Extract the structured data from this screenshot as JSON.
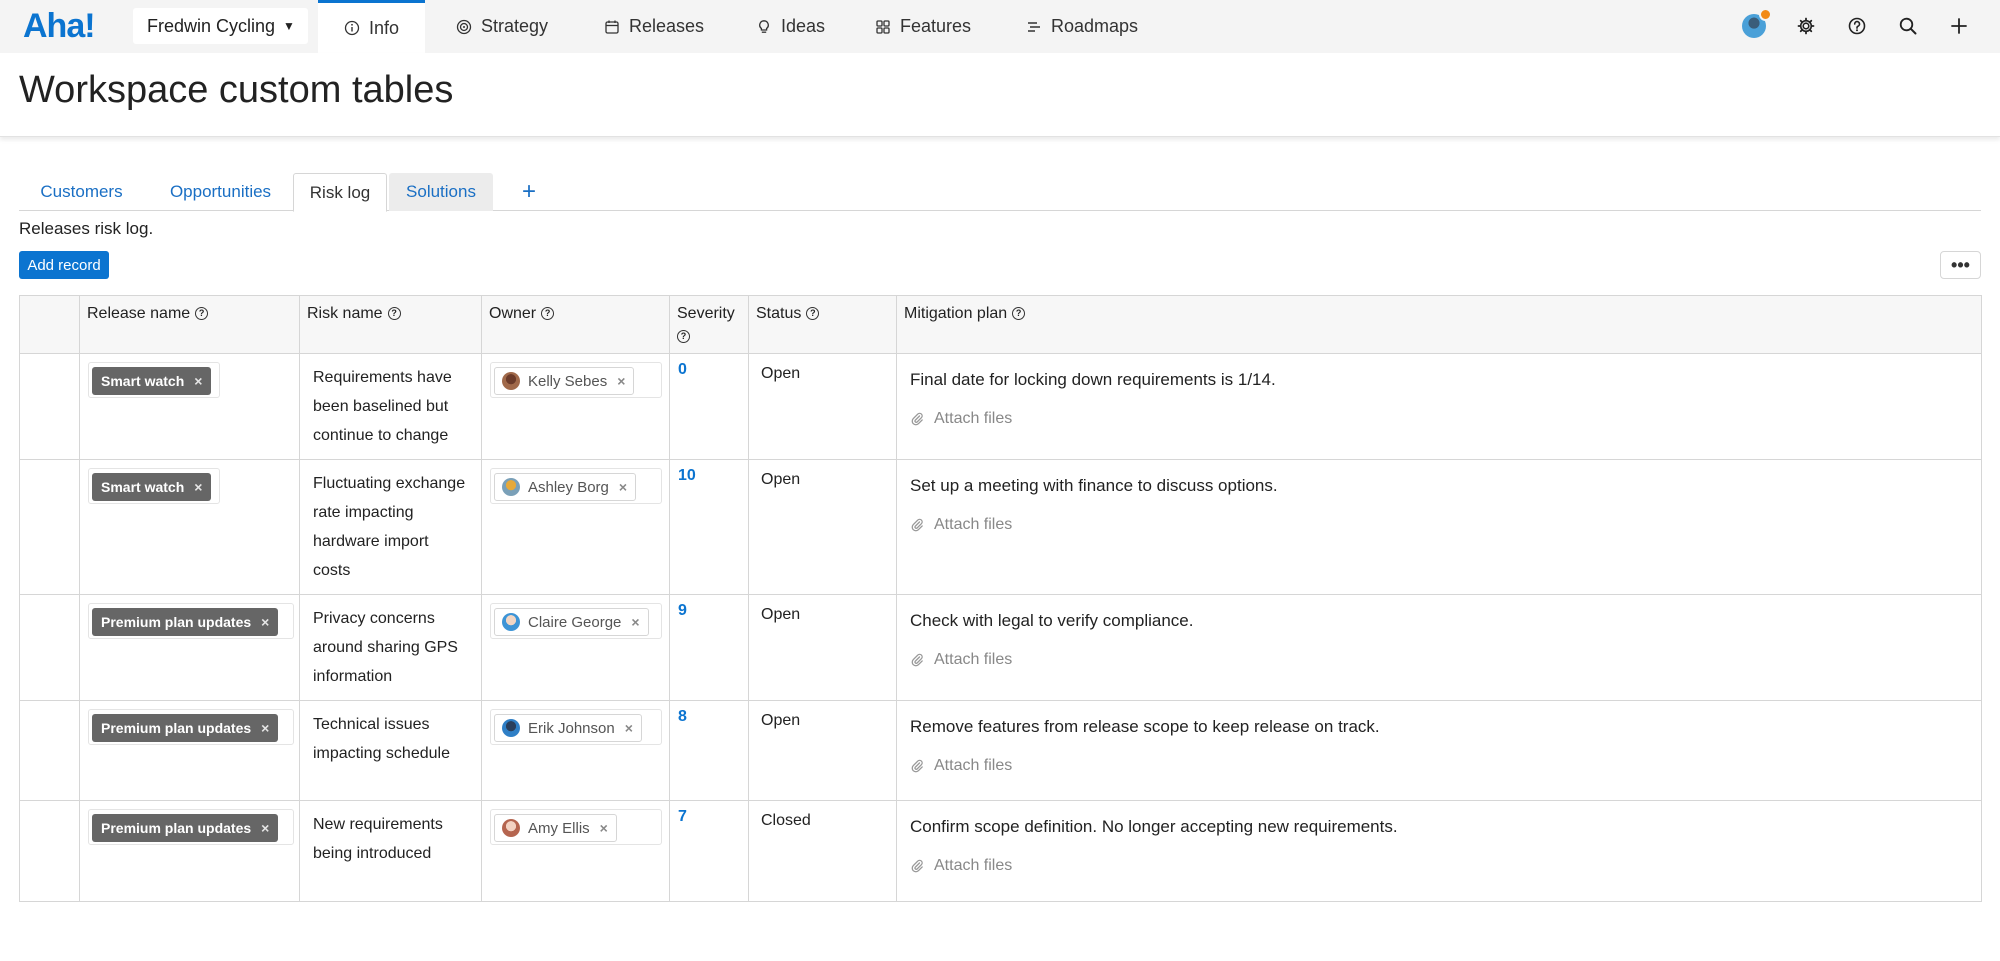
{
  "app": {
    "logo": "Aha!",
    "workspace": "Fredwin Cycling"
  },
  "nav": {
    "tabs": [
      {
        "label": "Info",
        "icon": "info-icon"
      },
      {
        "label": "Strategy",
        "icon": "target-icon"
      },
      {
        "label": "Releases",
        "icon": "calendar-icon"
      },
      {
        "label": "Ideas",
        "icon": "lightbulb-icon"
      },
      {
        "label": "Features",
        "icon": "grid-icon"
      },
      {
        "label": "Roadmaps",
        "icon": "roadmap-icon"
      }
    ],
    "active": "Info",
    "right_icons": [
      "user-avatar",
      "gear-icon",
      "help-icon",
      "search-icon",
      "plus-icon"
    ]
  },
  "page": {
    "title": "Workspace custom tables"
  },
  "tables": {
    "tabs": [
      "Customers",
      "Opportunities",
      "Risk log",
      "Solutions"
    ],
    "active": "Risk log",
    "add_tab": "+",
    "description": "Releases risk log.",
    "add_record_label": "Add record",
    "more_label": "•••"
  },
  "grid": {
    "columns": [
      "Release name",
      "Risk name",
      "Owner",
      "Severity",
      "Status",
      "Mitigation plan"
    ],
    "attach_label": "Attach files",
    "remove_label": "×",
    "rows": [
      {
        "release": "Smart watch",
        "risk": "Requirements have been baselined but continue to change",
        "owner": "Kelly Sebes",
        "severity": "0",
        "status": "Open",
        "mitigation": "Final date for locking down requirements is 1/14."
      },
      {
        "release": "Smart watch",
        "risk": "Fluctuating exchange rate impacting hardware import costs",
        "owner": "Ashley Borg",
        "severity": "10",
        "status": "Open",
        "mitigation": "Set up a meeting with finance to discuss options."
      },
      {
        "release": "Premium plan updates",
        "risk": "Privacy concerns around sharing GPS information",
        "owner": "Claire George",
        "severity": "9",
        "status": "Open",
        "mitigation": "Check with legal to verify compliance."
      },
      {
        "release": "Premium plan updates",
        "risk": "Technical issues impacting schedule",
        "owner": "Erik Johnson",
        "severity": "8",
        "status": "Open",
        "mitigation": "Remove features from release scope to keep release on track."
      },
      {
        "release": "Premium plan updates",
        "risk": "New requirements being introduced",
        "owner": "Amy Ellis",
        "severity": "7",
        "status": "Closed",
        "mitigation": "Confirm scope definition. No longer accepting new requirements."
      }
    ]
  },
  "colors": {
    "accent": "#0b74d0",
    "chip": "#666666",
    "notification": "#f28a16"
  }
}
